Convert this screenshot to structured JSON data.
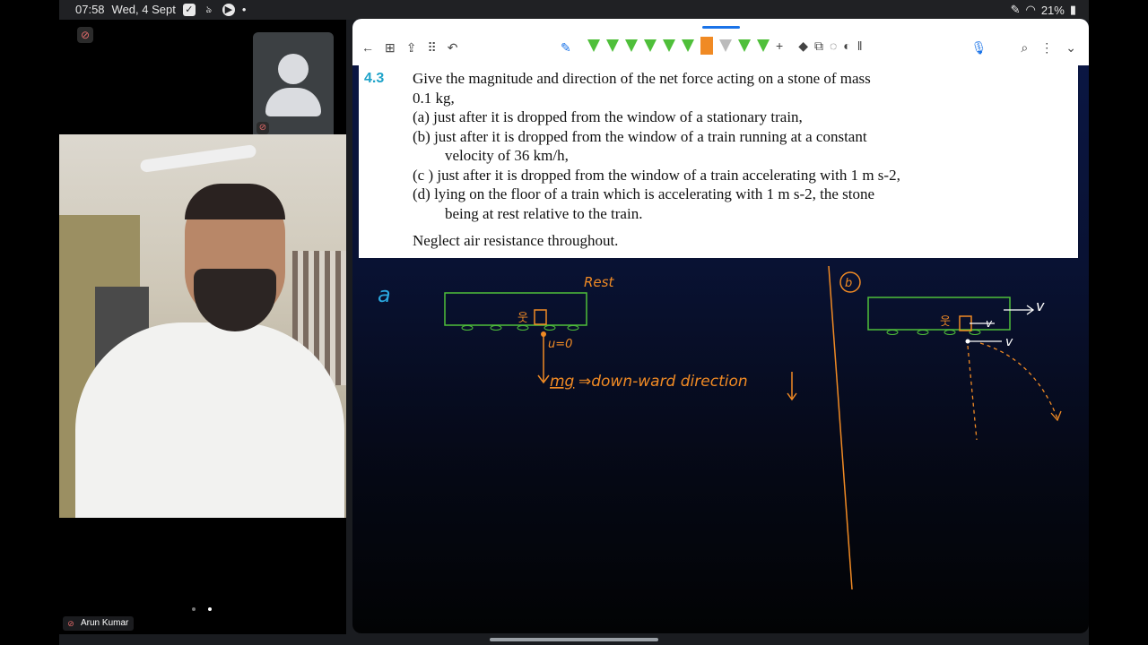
{
  "status_bar": {
    "time": "07:58",
    "date": "Wed, 4 Sept",
    "battery": "21%",
    "icons": [
      "check-icon",
      "app-icon",
      "play-icon",
      "dot-icon",
      "pen-icon",
      "wifi-icon",
      "signal-icon"
    ]
  },
  "meeting": {
    "participant_name": "Arun Kumar",
    "icons": [
      "mic-off-icon",
      "avatar-icon"
    ]
  },
  "question": {
    "number": "4.3",
    "lines": [
      "Give  the magnitude and direction of the net force acting on a stone of mass",
      "0.1 kg,",
      "(a)  just after it is dropped from the window of a stationary train,",
      "(b)  just after it is dropped from the window of a train running at a constant",
      "velocity of 36 km/h,",
      "(c )  just after it is dropped from the window of a train accelerating with 1 m s-2,",
      "(d)  lying on the floor of a train which is accelerating with 1 m s-2, the stone",
      "being at rest relative to the train."
    ],
    "note": "Neglect air resistance throughout."
  },
  "annotations": {
    "part_a_label": "a",
    "rest": "Rest",
    "u_zero": "u=0",
    "mg": "mg",
    "direction": "⇒down-ward direction",
    "part_b_label": "b",
    "v": "v"
  },
  "toolbar": {
    "icons": [
      "back-arrow-icon",
      "grid-icon",
      "share-icon",
      "apps-icon",
      "undo-icon",
      "pencil-icon",
      "pen-tool-icon",
      "add-icon",
      "eraser-icon",
      "shapes-icon",
      "lasso-icon",
      "highlighter-icon",
      "pause-icon",
      "mic-icon",
      "search-icon",
      "more-icon",
      "chevron-down-icon"
    ]
  },
  "colors": {
    "accent": "#1a73e8",
    "ink_orange": "#f08a24",
    "ink_green": "#4fbf3a",
    "question_number": "#1fa3c9"
  }
}
